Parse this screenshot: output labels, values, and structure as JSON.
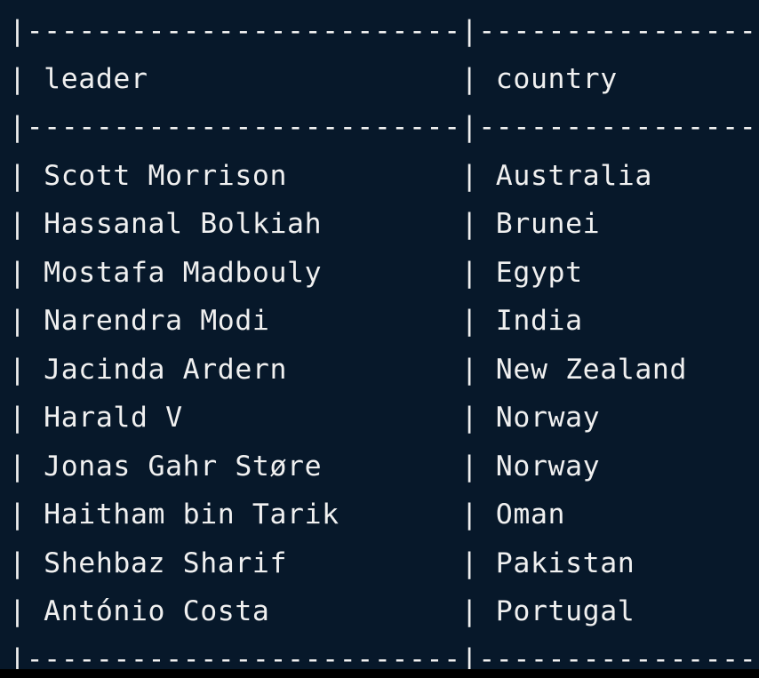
{
  "table": {
    "separator": "|-------------------------|----------------|",
    "header": "| leader                  | country        |",
    "rows": [
      "| Scott Morrison          | Australia      |",
      "| Hassanal Bolkiah        | Brunei         |",
      "| Mostafa Madbouly        | Egypt          |",
      "| Narendra Modi           | India          |",
      "| Jacinda Ardern          | New Zealand    |",
      "| Harald V                | Norway         |",
      "| Jonas Gahr Støre        | Norway         |",
      "| Haitham bin Tarik       | Oman           |",
      "| Shehbaz Sharif          | Pakistan       |",
      "| António Costa           | Portugal       |"
    ]
  }
}
